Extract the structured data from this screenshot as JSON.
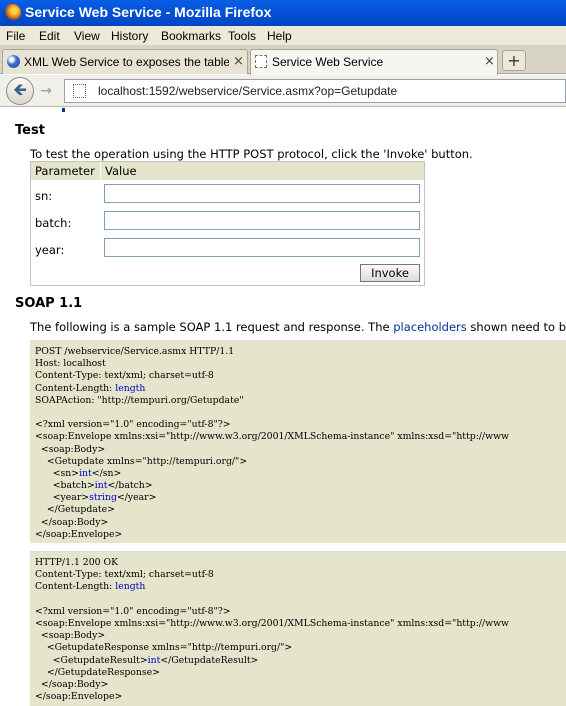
{
  "window": {
    "title": "Service Web Service - Mozilla Firefox"
  },
  "menu": [
    "File",
    "Edit",
    "View",
    "History",
    "Bookmarks",
    "Tools",
    "Help"
  ],
  "tabs": [
    {
      "label": "XML Web Service to exposes the table fr...",
      "close": "×",
      "icon": "globe-icon"
    },
    {
      "label": "Service Web Service",
      "close": "×",
      "icon": "blank-page-icon"
    }
  ],
  "new_tab": "+",
  "nav": {
    "back": "🡸",
    "forward": "→",
    "url": "localhost:1592/webservice/Service.asmx?op=Getupdate"
  },
  "test": {
    "heading": "Test",
    "intro": "To test the operation using the HTTP POST protocol, click the 'Invoke' button.",
    "col_parameter": "Parameter",
    "col_value": "Value",
    "params": [
      {
        "label": "sn:",
        "value": ""
      },
      {
        "label": "batch:",
        "value": ""
      },
      {
        "label": "year:",
        "value": ""
      }
    ],
    "invoke": "Invoke"
  },
  "soap": {
    "heading": "SOAP 1.1",
    "intro_before": "The following is a sample SOAP 1.1 request and response. The ",
    "intro_link": "placeholders",
    "intro_after": " shown need to be",
    "request_lines": [
      [
        {
          "t": "POST /webservice/Service.asmx HTTP/1.1"
        }
      ],
      [
        {
          "t": "Host: localhost"
        }
      ],
      [
        {
          "t": "Content-Type: text/xml; charset=utf-8"
        }
      ],
      [
        {
          "t": "Content-Length: "
        },
        {
          "t": "length",
          "ph": true
        }
      ],
      [
        {
          "t": "SOAPAction: \"http://tempuri.org/Getupdate\""
        }
      ],
      [
        {
          "t": ""
        }
      ],
      [
        {
          "t": "<?xml version=\"1.0\" encoding=\"utf-8\"?>"
        }
      ],
      [
        {
          "t": "<soap:Envelope xmlns:xsi=\"http://www.w3.org/2001/XMLSchema-instance\" xmlns:xsd=\"http://www"
        }
      ],
      [
        {
          "t": "  <soap:Body>"
        }
      ],
      [
        {
          "t": "    <Getupdate xmlns=\"http://tempuri.org/\">"
        }
      ],
      [
        {
          "t": "      <sn>"
        },
        {
          "t": "int",
          "ph": true
        },
        {
          "t": "</sn>"
        }
      ],
      [
        {
          "t": "      <batch>"
        },
        {
          "t": "int",
          "ph": true
        },
        {
          "t": "</batch>"
        }
      ],
      [
        {
          "t": "      <year>"
        },
        {
          "t": "string",
          "ph": true
        },
        {
          "t": "</year>"
        }
      ],
      [
        {
          "t": "    </Getupdate>"
        }
      ],
      [
        {
          "t": "  </soap:Body>"
        }
      ],
      [
        {
          "t": "</soap:Envelope>"
        }
      ]
    ],
    "response_lines": [
      [
        {
          "t": "HTTP/1.1 200 OK"
        }
      ],
      [
        {
          "t": "Content-Type: text/xml; charset=utf-8"
        }
      ],
      [
        {
          "t": "Content-Length: "
        },
        {
          "t": "length",
          "ph": true
        }
      ],
      [
        {
          "t": ""
        }
      ],
      [
        {
          "t": "<?xml version=\"1.0\" encoding=\"utf-8\"?>"
        }
      ],
      [
        {
          "t": "<soap:Envelope xmlns:xsi=\"http://www.w3.org/2001/XMLSchema-instance\" xmlns:xsd=\"http://www"
        }
      ],
      [
        {
          "t": "  <soap:Body>"
        }
      ],
      [
        {
          "t": "    <GetupdateResponse xmlns=\"http://tempuri.org/\">"
        }
      ],
      [
        {
          "t": "      <GetupdateResult>"
        },
        {
          "t": "int",
          "ph": true
        },
        {
          "t": "</GetupdateResult>"
        }
      ],
      [
        {
          "t": "    </GetupdateResponse>"
        }
      ],
      [
        {
          "t": "  </soap:Body>"
        }
      ],
      [
        {
          "t": "</soap:Envelope>"
        }
      ]
    ]
  }
}
